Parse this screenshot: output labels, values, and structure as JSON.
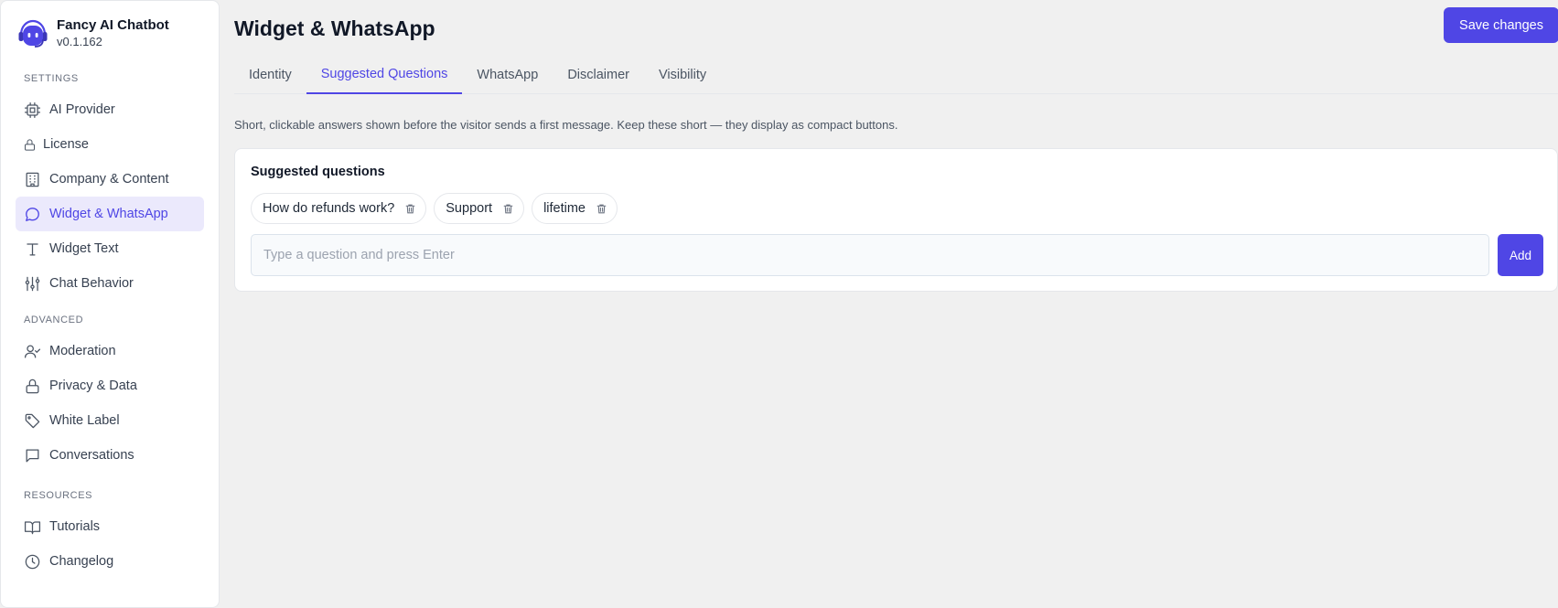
{
  "app": {
    "name": "Fancy AI Chatbot",
    "version": "v0.1.162",
    "logo": "robot-headset-icon",
    "accent": "#4f46e5"
  },
  "sidebar": {
    "sections": [
      {
        "label": "SETTINGS",
        "items": [
          {
            "label": "AI Provider",
            "icon": "cpu-icon"
          },
          {
            "label": "License",
            "icon": "lock-icon"
          },
          {
            "label": "Company & Content",
            "icon": "building-icon"
          },
          {
            "label": "Widget & WhatsApp",
            "icon": "chat-bubble-icon",
            "active": true
          },
          {
            "label": "Widget Text",
            "icon": "type-icon"
          },
          {
            "label": "Chat Behavior",
            "icon": "sliders-icon"
          }
        ]
      },
      {
        "label": "ADVANCED",
        "items": [
          {
            "label": "Moderation",
            "icon": "user-check-icon"
          },
          {
            "label": "Privacy & Data",
            "icon": "lock-icon"
          },
          {
            "label": "White Label",
            "icon": "tag-icon"
          },
          {
            "label": "Conversations",
            "icon": "message-square-icon"
          }
        ]
      },
      {
        "label": "RESOURCES",
        "items": [
          {
            "label": "Tutorials",
            "icon": "book-icon"
          },
          {
            "label": "Changelog",
            "icon": "clock-icon"
          }
        ]
      }
    ]
  },
  "header": {
    "title": "Widget & WhatsApp",
    "save_label": "Save changes"
  },
  "tabs": [
    {
      "label": "Identity"
    },
    {
      "label": "Suggested Questions",
      "active": true
    },
    {
      "label": "WhatsApp"
    },
    {
      "label": "Disclaimer"
    },
    {
      "label": "Visibility"
    }
  ],
  "content": {
    "help_text": "Short, clickable answers shown before the visitor sends a first message. Keep these short — they display as compact buttons.",
    "card_title": "Suggested questions",
    "questions": [
      "How do refunds work?",
      "Support",
      "lifetime"
    ],
    "input_value": "",
    "input_placeholder": "Type a question and press Enter",
    "add_label": "Add"
  }
}
